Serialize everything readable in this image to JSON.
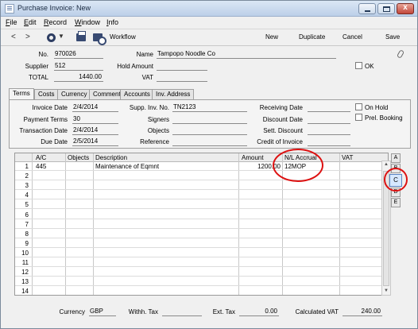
{
  "window": {
    "title": "Purchase Invoice: New",
    "close_glyph": "x"
  },
  "menu": [
    "File",
    "Edit",
    "Record",
    "Window",
    "Info"
  ],
  "menu_underline": [
    "F",
    "E",
    "R",
    "W",
    "I"
  ],
  "toolbar": {
    "prev": "<",
    "next": ">",
    "workflow": "Workflow",
    "new": "New",
    "duplicate": "Duplicate",
    "cancel": "Cancel",
    "save": "Save"
  },
  "header": {
    "no_label": "No.",
    "no": "970026",
    "name_label": "Name",
    "name": "Tampopo Noodle Co",
    "supplier_label": "Supplier",
    "supplier": "512",
    "hold_amount_label": "Hold Amount",
    "hold_amount": "",
    "ok_label": "OK",
    "total_label": "TOTAL",
    "total": "1440.00",
    "vat_label": "VAT",
    "vat": ""
  },
  "tabs": [
    "Terms",
    "Costs",
    "Currency",
    "Comment",
    "Accounts",
    "Inv. Address"
  ],
  "terms": {
    "invoice_date_label": "Invoice Date",
    "invoice_date": "2/4/2014",
    "payment_terms_label": "Payment Terms",
    "payment_terms": "30",
    "transaction_date_label": "Transaction Date",
    "transaction_date": "2/4/2014",
    "due_date_label": "Due Date",
    "due_date": "2/5/2014",
    "supp_inv_no_label": "Supp. Inv. No.",
    "supp_inv_no": "TN2123",
    "signers_label": "Signers",
    "signers": "",
    "objects_label": "Objects",
    "objects": "",
    "reference_label": "Reference",
    "reference": "",
    "receiving_date_label": "Receiving Date",
    "receiving_date": "",
    "discount_date_label": "Discount Date",
    "discount_date": "",
    "sett_discount_label": "Sett. Discount",
    "sett_discount": "",
    "credit_of_invoice_label": "Credit of Invoice",
    "credit_of_invoice": "",
    "on_hold_label": "On Hold",
    "prel_booking_label": "Prel. Booking"
  },
  "grid": {
    "headers": [
      "A/C",
      "Objects",
      "Description",
      "Amount",
      "N/L Accrual",
      "VAT"
    ],
    "row_numbers": [
      "1",
      "2",
      "3",
      "4",
      "5",
      "6",
      "7",
      "8",
      "9",
      "10",
      "11",
      "12",
      "13",
      "14"
    ],
    "rows": [
      {
        "ac": "445",
        "objects": "",
        "description": "Maintenance of Eqmnt",
        "amount": "1200.00",
        "nl_accrual": "12MOP",
        "vat": ""
      }
    ]
  },
  "matrix_tabs": [
    "A",
    "B",
    "C",
    "D",
    "E"
  ],
  "matrix_tab_selected": "C",
  "footer": {
    "currency_label": "Currency",
    "currency": "GBP",
    "withh_tax_label": "Withh. Tax",
    "withh_tax": "",
    "ext_tax_label": "Ext. Tax",
    "ext_tax": "0.00",
    "calculated_vat_label": "Calculated VAT",
    "calculated_vat": "240.00"
  },
  "colors": {
    "annotation": "#dd1111",
    "title_bar": "#bccfe8"
  },
  "icons": [
    "app-icon",
    "minimize-icon",
    "maximize-icon",
    "close-icon",
    "gear-icon",
    "print-icon",
    "print-preview-icon",
    "paperclip-icon"
  ]
}
